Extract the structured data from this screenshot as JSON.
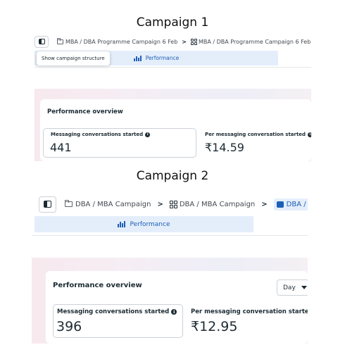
{
  "headings": {
    "campaign1": "Campaign 1",
    "campaign2": "Campaign 2"
  },
  "colors": {
    "accent": "#1d5fb4",
    "tab_bg": "#e4eefb",
    "text": "#1c2b33",
    "border": "#cbd2d9"
  },
  "campaign1": {
    "breadcrumb": {
      "campaign": "MBA / DBA Programme Campaign 6 Feb",
      "separator": ">",
      "ad_set": "MBA / DBA Programme Campaign 6 Feb"
    },
    "tooltip": "Show campaign structure",
    "tab_label": "Performance",
    "overview_title": "Performance overview",
    "metrics": [
      {
        "label": "Messaging conversations started",
        "value": "441"
      },
      {
        "label": "Per messaging conversation started",
        "value": "₹14.59"
      }
    ]
  },
  "campaign2": {
    "breadcrumb": {
      "campaign": "DBA / MBA Campaign",
      "separator": ">",
      "ad_set": "DBA / MBA Campaign",
      "ad": "DBA / MBA"
    },
    "tab_label": "Performance",
    "overview_title": "Performance overview",
    "range_select": "Day",
    "metrics": [
      {
        "label": "Messaging conversations started",
        "value": "396"
      },
      {
        "label": "Per messaging conversation started",
        "value": "₹12.95"
      }
    ]
  }
}
